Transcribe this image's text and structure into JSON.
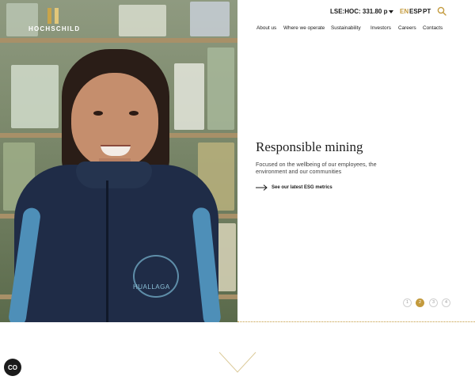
{
  "brand": {
    "logo_text": "HOCHSCHILD",
    "accent_color": "#c39a3d"
  },
  "header": {
    "stock_ticker": "LSE:HOC: 331.80 p",
    "languages": [
      "EN",
      "ESP",
      "PT"
    ],
    "active_language": "EN",
    "nav": [
      "About us",
      "Where we operate",
      "Sustainability",
      "Investors",
      "Careers",
      "Contacts"
    ]
  },
  "hero": {
    "title": "Responsible mining",
    "description": "Focused on the wellbeing of our employees, the environment and our communities",
    "cta_label": "See our latest ESG metrics",
    "photo_emblem_text": "HUALLAGA"
  },
  "pagination": {
    "slides": [
      "1",
      "2",
      "3",
      "4"
    ],
    "active_index": 1
  },
  "icons": {
    "search": "search-icon",
    "arrow": "arrow-right-icon",
    "chevron": "chevron-down-icon",
    "cookie": "cookie-consent-icon"
  },
  "cookie_label": "CO"
}
